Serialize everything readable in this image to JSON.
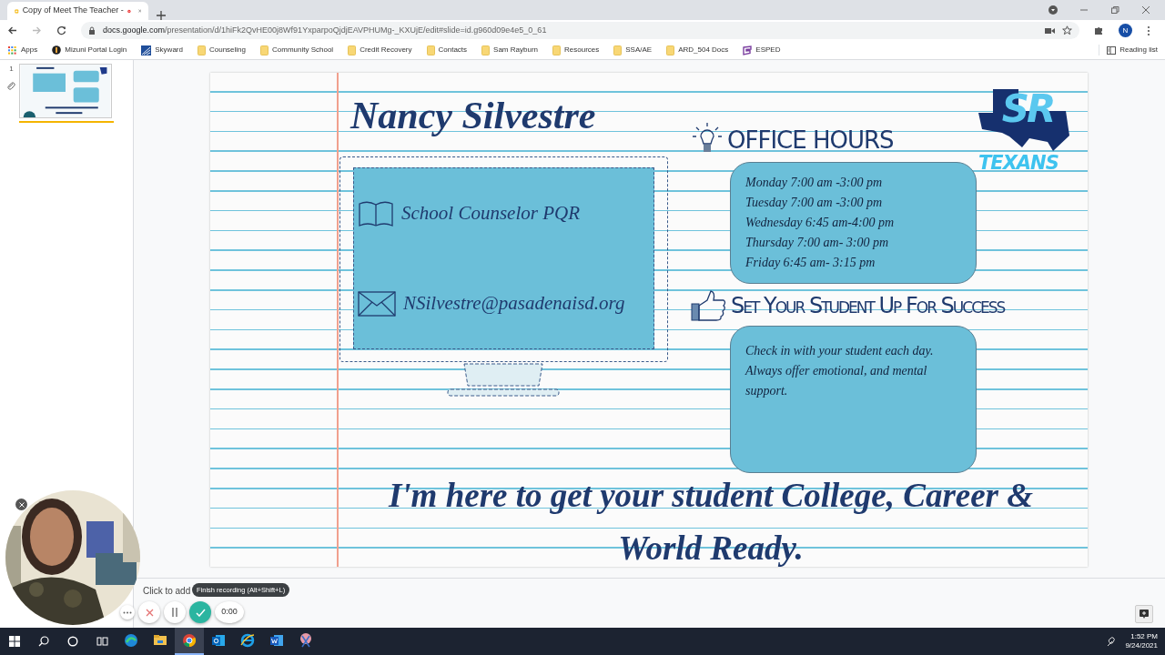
{
  "browser": {
    "tab": {
      "title": "Copy of Meet The Teacher -",
      "recording": true
    },
    "url": {
      "host": "docs.google.com",
      "path": "/presentation/d/1hiFk2QvHE00j8Wf91YxparpoQjdjEAVPHUMg-_KXUjE/edit#slide=id.g960d09e4e5_0_61"
    },
    "profile": "N",
    "bookmarks": [
      {
        "label": "Apps",
        "kind": "apps"
      },
      {
        "label": "Mizuni Portal Login",
        "kind": "portal"
      },
      {
        "label": "Skyward",
        "kind": "skyward"
      },
      {
        "label": "Counseling",
        "kind": "folder"
      },
      {
        "label": "Community School",
        "kind": "folder"
      },
      {
        "label": "Credit Recovery",
        "kind": "folder"
      },
      {
        "label": "Contacts",
        "kind": "folder"
      },
      {
        "label": "Sam Rayburn",
        "kind": "folder"
      },
      {
        "label": "Resources",
        "kind": "folder"
      },
      {
        "label": "SSA/AE",
        "kind": "folder"
      },
      {
        "label": "ARD_504 Docs",
        "kind": "folder"
      },
      {
        "label": "ESPED",
        "kind": "esped"
      }
    ],
    "reading_list": "Reading list"
  },
  "filmstrip": [
    {
      "number": "1",
      "selected": true
    }
  ],
  "slide": {
    "title": "Nancy Silvestre",
    "contact": [
      {
        "kind": "role",
        "text": "School Counselor PQR"
      },
      {
        "kind": "email",
        "text": "NSilvestre@pasadenaisd.org"
      }
    ],
    "logo": {
      "initials": "SR",
      "name": "TEXANS"
    },
    "office_hours": {
      "heading": "OFFICE HOURS",
      "hours": [
        "Monday 7:00 am -3:00 pm",
        "Tuesday 7:00 am -3:00 pm",
        "Wednesday 6:45 am-4:00 pm",
        "Thursday 7:00 am- 3:00 pm",
        "Friday 6:45 am- 3:15 pm"
      ]
    },
    "success": {
      "heading": "Set Your Student Up For Success",
      "text": "Check in with your student each day. Always offer emotional, and mental support."
    },
    "tagline": "I'm here to get your student College, Career & World Ready."
  },
  "speaker_notes": {
    "placeholder": "Click to add"
  },
  "recorder": {
    "tooltip": "Finish recording (Alt+Shift+L)",
    "time": "0:00"
  },
  "taskbar": {
    "apps": [
      {
        "kind": "edge",
        "selected": false
      },
      {
        "kind": "files",
        "selected": false
      },
      {
        "kind": "chrome",
        "selected": true
      },
      {
        "kind": "outlook",
        "selected": false
      },
      {
        "kind": "ie",
        "selected": false
      },
      {
        "kind": "word",
        "selected": false
      },
      {
        "kind": "snip",
        "selected": false
      }
    ],
    "time": "1:52 PM",
    "date": "9/24/2021"
  }
}
